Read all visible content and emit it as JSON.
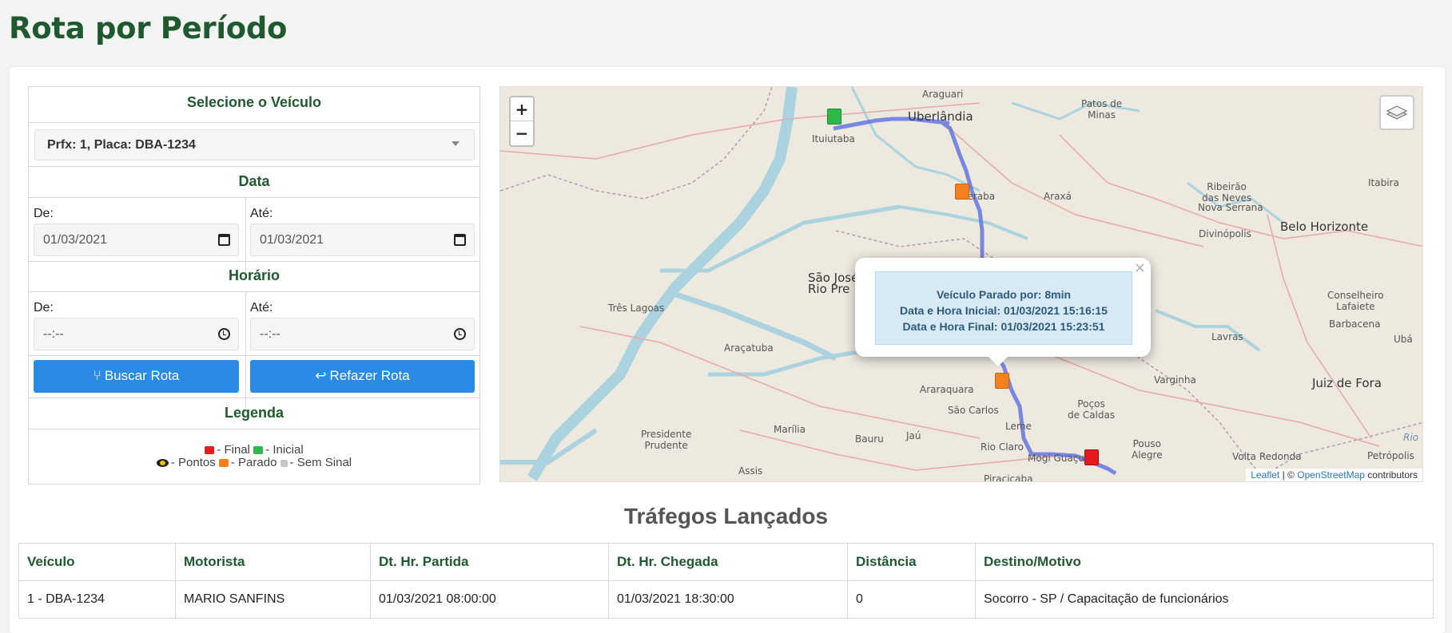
{
  "page": {
    "title": "Rota por Período"
  },
  "vehicle": {
    "header": "Selecione o Veículo",
    "selected": "Prfx: 1, Placa: DBA-1234"
  },
  "date": {
    "header": "Data",
    "from_label": "De:",
    "from_value": "01/03/2021",
    "to_label": "Até:",
    "to_value": "01/03/2021"
  },
  "time": {
    "header": "Horário",
    "from_label": "De:",
    "from_value": "--:--",
    "to_label": "Até:",
    "to_value": "--:--"
  },
  "actions": {
    "search_label": "Buscar Rota",
    "redo_label": "Refazer Rota"
  },
  "legend": {
    "header": "Legenda",
    "final": "- Final",
    "inicial": "- Inicial",
    "pontos": "- Pontos",
    "parado": "- Parado",
    "sem_sinal": "- Sem Sinal"
  },
  "map": {
    "zoom_in": "+",
    "zoom_out": "−",
    "places": {
      "araguari": "Araguari",
      "patos": "Patos de\nMinas",
      "ituiutaba": "Ituiutaba",
      "uberlandia": "Uberlândia",
      "uberaba": "Uberaba",
      "araxa": "Araxá",
      "ribeirao_neves": "Ribeirão\ndas Neves",
      "itabira": "Itabira",
      "nova_serrana": "Nova Serrana",
      "belo_horizonte": "Belo Horizonte",
      "divinopolis": "Divinópolis",
      "sao_jose": "São José\nRio Pre",
      "tres_lagoas": "Três Lagoas",
      "araçatuba": "Araçatuba",
      "conselheiro": "Conselheiro\nLafaiete",
      "barbacena": "Barbacena",
      "lavras": "Lavras",
      "uba": "Ubá",
      "varginha": "Varginha",
      "juiz_de_fora": "Juiz de Fora",
      "araraquara": "Araraquara",
      "sao_carlos": "São Carlos",
      "pocos": "Poços\nde Caldas",
      "presidente": "Presidente\nPrudente",
      "marilia": "Marília",
      "bauru": "Bauru",
      "jau": "Jaú",
      "leme": "Leme",
      "rio_claro": "Rio Claro",
      "mogi": "Mogi Guaçu",
      "pouso": "Pouso\nAlegre",
      "volta_redonda": "Volta Redonda",
      "petropolis": "Petrópolis",
      "rio": "Rio",
      "assis": "Assis",
      "piracicaba": "Piracicaba"
    },
    "popup": {
      "line1": "Veículo Parado por: 8min",
      "line2": "Data e Hora Inicial: 01/03/2021 15:16:15",
      "line3": "Data e Hora Final: 01/03/2021 15:23:51",
      "close": "×"
    },
    "attribution": {
      "leaflet": "Leaflet",
      "sep": "| ©",
      "osm": "OpenStreetMap",
      "rest": "contributors"
    }
  },
  "traffic": {
    "title": "Tráfegos Lançados",
    "headers": [
      "Veículo",
      "Motorista",
      "Dt. Hr. Partida",
      "Dt. Hr. Chegada",
      "Distância",
      "Destino/Motivo"
    ],
    "rows": [
      [
        "1 - DBA-1234",
        "MARIO SANFINS",
        "01/03/2021 08:00:00",
        "01/03/2021 18:30:00",
        "0",
        "Socorro - SP / Capacitação de funcionários"
      ]
    ]
  },
  "colors": {
    "brand_green": "#1e5a2e",
    "button_blue": "#2a8be6",
    "route": "#5a6fe0"
  }
}
